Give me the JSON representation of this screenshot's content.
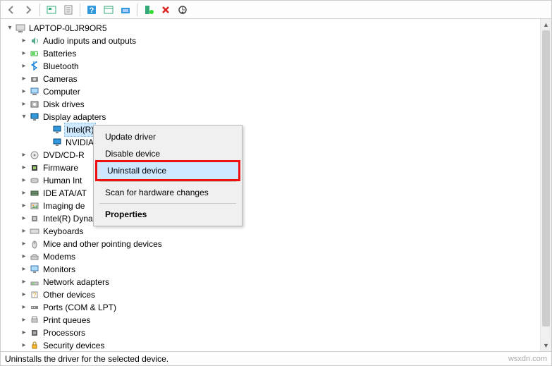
{
  "toolbar": {
    "back": "Back",
    "forward": "Forward",
    "show_hidden": "Show hidden",
    "properties": "Properties",
    "help": "Help",
    "view": "View",
    "scan": "Scan",
    "add": "Add",
    "remove": "Remove",
    "update": "Update"
  },
  "root": {
    "label": "LAPTOP-0LJR9OR5"
  },
  "categories": [
    {
      "label": "Audio inputs and outputs",
      "expanded": false,
      "icon": "audio"
    },
    {
      "label": "Batteries",
      "expanded": false,
      "icon": "battery"
    },
    {
      "label": "Bluetooth",
      "expanded": false,
      "icon": "bluetooth"
    },
    {
      "label": "Cameras",
      "expanded": false,
      "icon": "camera"
    },
    {
      "label": "Computer",
      "expanded": false,
      "icon": "computer"
    },
    {
      "label": "Disk drives",
      "expanded": false,
      "icon": "disk"
    },
    {
      "label": "Display adapters",
      "expanded": true,
      "icon": "display",
      "children": [
        {
          "label": "Intel(R)",
          "selected": true,
          "icon": "display"
        },
        {
          "label": "NVIDIA",
          "selected": false,
          "icon": "display"
        }
      ]
    },
    {
      "label": "DVD/CD-R",
      "expanded": false,
      "icon": "dvd",
      "truncated": true
    },
    {
      "label": "Firmware",
      "expanded": false,
      "icon": "firmware"
    },
    {
      "label": "Human Int",
      "expanded": false,
      "icon": "hid",
      "truncated": true
    },
    {
      "label": "IDE ATA/AT",
      "expanded": false,
      "icon": "ide",
      "truncated": true
    },
    {
      "label": "Imaging de",
      "expanded": false,
      "icon": "imaging",
      "truncated": true
    },
    {
      "label": "Intel(R) Dynamic Platform and Thermal Framework",
      "expanded": false,
      "icon": "cpu"
    },
    {
      "label": "Keyboards",
      "expanded": false,
      "icon": "keyboard"
    },
    {
      "label": "Mice and other pointing devices",
      "expanded": false,
      "icon": "mouse"
    },
    {
      "label": "Modems",
      "expanded": false,
      "icon": "modem"
    },
    {
      "label": "Monitors",
      "expanded": false,
      "icon": "monitor"
    },
    {
      "label": "Network adapters",
      "expanded": false,
      "icon": "network"
    },
    {
      "label": "Other devices",
      "expanded": false,
      "icon": "other"
    },
    {
      "label": "Ports (COM & LPT)",
      "expanded": false,
      "icon": "port"
    },
    {
      "label": "Print queues",
      "expanded": false,
      "icon": "printer"
    },
    {
      "label": "Processors",
      "expanded": false,
      "icon": "processor"
    },
    {
      "label": "Security devices",
      "expanded": false,
      "icon": "security"
    }
  ],
  "context_menu": {
    "update_driver": "Update driver",
    "disable_device": "Disable device",
    "uninstall_device": "Uninstall device",
    "scan_changes": "Scan for hardware changes",
    "properties": "Properties"
  },
  "statusbar": {
    "text": "Uninstalls the driver for the selected device."
  },
  "watermark": "wsxdn.com"
}
